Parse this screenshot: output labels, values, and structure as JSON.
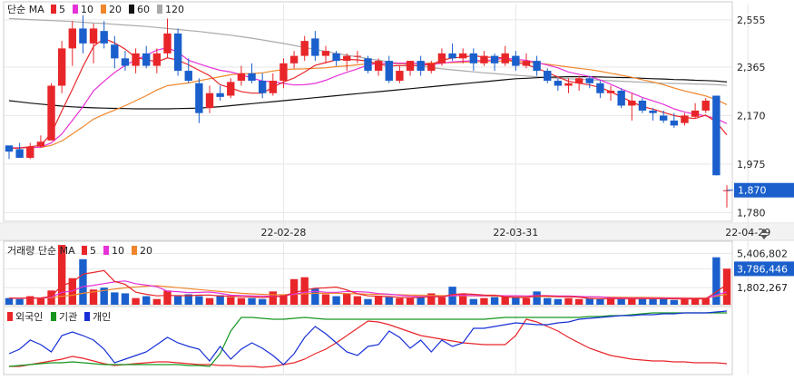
{
  "colors": {
    "up": "#e8262a",
    "down": "#1a5fcc",
    "ma5": "#e8262a",
    "ma10": "#e632d8",
    "ma20": "#f0862b",
    "ma60": "#111111",
    "ma120": "#aaaaaa",
    "foreign": "#e8262a",
    "institution": "#14961e",
    "individual": "#1730d6",
    "grid": "#e6e6e6",
    "axis_text": "#222222",
    "current_price_bg": "#1a5fcc"
  },
  "price_legend": {
    "prefix": "단순 MA",
    "items": [
      {
        "label": "5",
        "color": "#e8262a"
      },
      {
        "label": "10",
        "color": "#e632d8"
      },
      {
        "label": "20",
        "color": "#f0862b"
      },
      {
        "label": "60",
        "color": "#111111"
      },
      {
        "label": "120",
        "color": "#aaaaaa"
      }
    ]
  },
  "volume_legend": {
    "prefix": "거래량 단순 MA",
    "items": [
      {
        "label": "5",
        "color": "#e8262a"
      },
      {
        "label": "10",
        "color": "#e632d8"
      },
      {
        "label": "20",
        "color": "#f0862b"
      }
    ]
  },
  "investor_legend": {
    "items": [
      {
        "label": "외국인",
        "color": "#e8262a"
      },
      {
        "label": "기관",
        "color": "#14961e"
      },
      {
        "label": "개인",
        "color": "#1730d6"
      }
    ]
  },
  "chart_data": {
    "type": "candlestick",
    "price_axis": {
      "ticks": [
        2555,
        2365,
        2170,
        1975,
        1780
      ],
      "labels": [
        "2,555",
        "2,365",
        "2,170",
        "1,975",
        "1,780"
      ],
      "range": [
        1745,
        2620
      ]
    },
    "current_price": {
      "value": 1870,
      "label": "1,870"
    },
    "date_labels": [
      {
        "label": "22-02-28",
        "index": 26
      },
      {
        "label": "22-03-31",
        "index": 48
      },
      {
        "label": "22-04-29",
        "index": 70
      }
    ],
    "candles": [
      [
        2050,
        2045,
        1995,
        2025
      ],
      [
        2035,
        2060,
        2000,
        2000
      ],
      [
        2000,
        2060,
        1995,
        2045
      ],
      [
        2045,
        2090,
        2040,
        2065
      ],
      [
        2070,
        2300,
        2070,
        2290
      ],
      [
        2290,
        2470,
        2260,
        2440
      ],
      [
        2440,
        2550,
        2370,
        2520
      ],
      [
        2520,
        2600,
        2420,
        2460
      ],
      [
        2460,
        2540,
        2380,
        2520
      ],
      [
        2510,
        2550,
        2440,
        2460
      ],
      [
        2455,
        2490,
        2360,
        2400
      ],
      [
        2400,
        2430,
        2350,
        2370
      ],
      [
        2370,
        2440,
        2340,
        2420
      ],
      [
        2420,
        2450,
        2360,
        2370
      ],
      [
        2370,
        2440,
        2340,
        2420
      ],
      [
        2420,
        2560,
        2400,
        2500
      ],
      [
        2500,
        2520,
        2330,
        2350
      ],
      [
        2350,
        2400,
        2300,
        2310
      ],
      [
        2300,
        2320,
        2140,
        2180
      ],
      [
        2200,
        2290,
        2180,
        2260
      ],
      [
        2260,
        2290,
        2230,
        2245
      ],
      [
        2250,
        2320,
        2240,
        2305
      ],
      [
        2310,
        2370,
        2290,
        2340
      ],
      [
        2340,
        2380,
        2300,
        2310
      ],
      [
        2310,
        2340,
        2240,
        2260
      ],
      [
        2260,
        2340,
        2250,
        2310
      ],
      [
        2310,
        2400,
        2280,
        2380
      ],
      [
        2380,
        2430,
        2360,
        2410
      ],
      [
        2410,
        2490,
        2390,
        2470
      ],
      [
        2480,
        2510,
        2390,
        2410
      ],
      [
        2410,
        2450,
        2380,
        2430
      ],
      [
        2420,
        2430,
        2370,
        2390
      ],
      [
        2390,
        2420,
        2350,
        2410
      ],
      [
        2410,
        2430,
        2380,
        2410
      ],
      [
        2400,
        2410,
        2340,
        2350
      ],
      [
        2350,
        2400,
        2330,
        2390
      ],
      [
        2390,
        2410,
        2300,
        2310
      ],
      [
        2310,
        2370,
        2300,
        2350
      ],
      [
        2350,
        2390,
        2330,
        2390
      ],
      [
        2390,
        2410,
        2330,
        2350
      ],
      [
        2350,
        2390,
        2340,
        2380
      ],
      [
        2380,
        2440,
        2370,
        2420
      ],
      [
        2420,
        2460,
        2390,
        2400
      ],
      [
        2400,
        2440,
        2380,
        2420
      ],
      [
        2420,
        2440,
        2350,
        2380
      ],
      [
        2380,
        2430,
        2370,
        2410
      ],
      [
        2410,
        2420,
        2350,
        2380
      ],
      [
        2380,
        2450,
        2370,
        2420
      ],
      [
        2410,
        2430,
        2350,
        2370
      ],
      [
        2370,
        2420,
        2360,
        2390
      ],
      [
        2390,
        2410,
        2330,
        2350
      ],
      [
        2350,
        2360,
        2300,
        2310
      ],
      [
        2310,
        2320,
        2270,
        2290
      ],
      [
        2290,
        2320,
        2260,
        2300
      ],
      [
        2300,
        2330,
        2270,
        2320
      ],
      [
        2320,
        2330,
        2280,
        2300
      ],
      [
        2300,
        2310,
        2240,
        2260
      ],
      [
        2260,
        2290,
        2230,
        2270
      ],
      [
        2270,
        2280,
        2200,
        2210
      ],
      [
        2210,
        2260,
        2150,
        2230
      ],
      [
        2230,
        2240,
        2180,
        2190
      ],
      [
        2190,
        2200,
        2150,
        2180
      ],
      [
        2170,
        2190,
        2140,
        2150
      ],
      [
        2150,
        2180,
        2120,
        2130
      ],
      [
        2140,
        2180,
        2130,
        2170
      ],
      [
        2165,
        2220,
        2160,
        2190
      ],
      [
        2190,
        2240,
        2180,
        2230
      ],
      [
        2250,
        2020,
        1930,
        1930
      ],
      [
        1870,
        1890,
        1800,
        1870
      ]
    ],
    "ma5": [
      2038,
      2040,
      2045,
      2050,
      2098,
      2189,
      2276,
      2367,
      2448,
      2480,
      2462,
      2437,
      2403,
      2395,
      2386,
      2402,
      2393,
      2374,
      2352,
      2330,
      2294,
      2281,
      2266,
      2260,
      2260,
      2284,
      2305,
      2321,
      2345,
      2372,
      2383,
      2394,
      2396,
      2394,
      2389,
      2377,
      2369,
      2371,
      2371,
      2372,
      2375,
      2392,
      2402,
      2405,
      2411,
      2405,
      2404,
      2401,
      2385,
      2375,
      2361,
      2343,
      2325,
      2308,
      2300,
      2293,
      2283,
      2266,
      2245,
      2225,
      2206,
      2196,
      2183,
      2170,
      2162,
      2158,
      2172,
      2144,
      2092
    ],
    "ma10": [
      2040,
      2041,
      2042,
      2043,
      2060,
      2096,
      2151,
      2206,
      2270,
      2308,
      2343,
      2372,
      2394,
      2413,
      2433,
      2443,
      2424,
      2392,
      2378,
      2364,
      2352,
      2345,
      2334,
      2321,
      2309,
      2306,
      2299,
      2293,
      2294,
      2299,
      2312,
      2329,
      2344,
      2358,
      2373,
      2380,
      2380,
      2381,
      2381,
      2380,
      2375,
      2380,
      2386,
      2388,
      2391,
      2391,
      2395,
      2401,
      2396,
      2392,
      2383,
      2373,
      2362,
      2345,
      2336,
      2327,
      2313,
      2296,
      2277,
      2260,
      2243,
      2229,
      2215,
      2197,
      2184,
      2176,
      2169,
      2157,
      2138
    ],
    "ma20": [
      2040,
      2040,
      2041,
      2042,
      2050,
      2068,
      2096,
      2125,
      2156,
      2175,
      2192,
      2210,
      2230,
      2250,
      2273,
      2290,
      2296,
      2301,
      2310,
      2318,
      2326,
      2334,
      2338,
      2339,
      2342,
      2349,
      2355,
      2357,
      2358,
      2360,
      2362,
      2367,
      2370,
      2374,
      2378,
      2380,
      2379,
      2378,
      2379,
      2380,
      2381,
      2382,
      2383,
      2384,
      2386,
      2387,
      2388,
      2390,
      2389,
      2386,
      2381,
      2376,
      2371,
      2365,
      2360,
      2355,
      2348,
      2340,
      2332,
      2324,
      2314,
      2305,
      2294,
      2281,
      2269,
      2259,
      2249,
      2234,
      2214
    ],
    "ma60": [
      2230,
      2225,
      2220,
      2216,
      2212,
      2208,
      2205,
      2203,
      2201,
      2200,
      2199,
      2198,
      2197,
      2197,
      2197,
      2197,
      2198,
      2199,
      2200,
      2203,
      2206,
      2210,
      2214,
      2218,
      2222,
      2226,
      2230,
      2234,
      2238,
      2242,
      2246,
      2250,
      2254,
      2258,
      2262,
      2266,
      2270,
      2274,
      2278,
      2282,
      2286,
      2290,
      2294,
      2298,
      2302,
      2306,
      2310,
      2314,
      2318,
      2320,
      2322,
      2324,
      2325,
      2326,
      2326,
      2326,
      2325,
      2324,
      2323,
      2322,
      2320,
      2318,
      2317,
      2315,
      2314,
      2312,
      2311,
      2309,
      2305
    ],
    "ma120": [
      2560,
      2558,
      2556,
      2554,
      2552,
      2550,
      2548,
      2545,
      2542,
      2540,
      2537,
      2534,
      2531,
      2528,
      2524,
      2520,
      2516,
      2512,
      2508,
      2503,
      2498,
      2493,
      2487,
      2481,
      2474,
      2467,
      2460,
      2452,
      2444,
      2436,
      2428,
      2420,
      2413,
      2406,
      2399,
      2392,
      2386,
      2380,
      2374,
      2368,
      2363,
      2358,
      2354,
      2350,
      2346,
      2342,
      2339,
      2335,
      2332,
      2329,
      2326,
      2323,
      2320,
      2318,
      2316,
      2314,
      2312,
      2310,
      2308,
      2306,
      2304,
      2302,
      2300,
      2299,
      2298,
      2297,
      2296,
      2294,
      2291
    ],
    "volume_axis": {
      "ticks": [
        5406802,
        3786446,
        1802267
      ],
      "labels": [
        "5,406,802",
        "3,786,446",
        "1,802,267"
      ],
      "max": 6500000
    },
    "volume": [
      700000,
      600000,
      900000,
      700000,
      1500000,
      6300000,
      2800000,
      4800000,
      1600000,
      1800000,
      1300000,
      1200000,
      700000,
      900000,
      600000,
      1500000,
      900000,
      1100000,
      900000,
      700000,
      1000000,
      800000,
      700000,
      700000,
      600000,
      1400000,
      1000000,
      2700000,
      2900000,
      1700000,
      1100000,
      900000,
      1200000,
      900000,
      600000,
      900000,
      800000,
      700000,
      700000,
      800000,
      1200000,
      800000,
      1900000,
      1100000,
      600000,
      700000,
      800000,
      900000,
      800000,
      700000,
      1400000,
      700000,
      600000,
      700000,
      600000,
      700000,
      600000,
      700000,
      600000,
      700000,
      600000,
      600000,
      700000,
      500000,
      600000,
      600000,
      700000,
      5000000,
      3800000
    ],
    "vol_ma5": [
      700000,
      680000,
      700000,
      720000,
      880000,
      2040000,
      2360000,
      3220000,
      3400000,
      3600000,
      2460000,
      2140000,
      1320000,
      1100000,
      940000,
      980000,
      960000,
      960000,
      1000000,
      1020000,
      920000,
      900000,
      840000,
      820000,
      760000,
      840000,
      900000,
      1280000,
      1540000,
      1740000,
      1780000,
      1860000,
      1560000,
      1160000,
      940000,
      900000,
      860000,
      780000,
      740000,
      780000,
      840000,
      840000,
      1080000,
      1160000,
      1100000,
      1020000,
      1000000,
      820000,
      760000,
      760000,
      920000,
      920000,
      840000,
      840000,
      800000,
      660000,
      640000,
      640000,
      640000,
      640000,
      640000,
      640000,
      640000,
      620000,
      600000,
      600000,
      620000,
      1360000,
      2120000
    ],
    "vol_ma10": [
      700000,
      690000,
      700000,
      705000,
      790000,
      1300000,
      1450000,
      1900000,
      2050000,
      2230000,
      2400000,
      2500000,
      2220000,
      2060000,
      1900000,
      1420000,
      1380000,
      1280000,
      1300000,
      1340000,
      1200000,
      1000000,
      980000,
      940000,
      910000,
      890000,
      930000,
      1120000,
      1300000,
      1410000,
      1320000,
      1310000,
      1400000,
      1380000,
      1320000,
      1180000,
      1110000,
      1000000,
      900000,
      860000,
      870000,
      850000,
      970000,
      990000,
      970000,
      960000,
      980000,
      950000,
      950000,
      930000,
      970000,
      960000,
      920000,
      930000,
      880000,
      840000,
      820000,
      730000,
      710000,
      700000,
      700000,
      690000,
      700000,
      680000,
      660000,
      650000,
      650000,
      1000000,
      1370000
    ],
    "vol_ma20": [
      700000,
      700000,
      700000,
      700000,
      740000,
      900000,
      1000000,
      1200000,
      1350000,
      1500000,
      1650000,
      1780000,
      1880000,
      1950000,
      2000000,
      1900000,
      1800000,
      1700000,
      1600000,
      1500000,
      1400000,
      1300000,
      1200000,
      1150000,
      1100000,
      1050000,
      1050000,
      1100000,
      1150000,
      1200000,
      1200000,
      1200000,
      1180000,
      1150000,
      1120000,
      1100000,
      1080000,
      1050000,
      1020000,
      1000000,
      980000,
      960000,
      950000,
      940000,
      930000,
      920000,
      910000,
      900000,
      890000,
      880000,
      870000,
      860000,
      850000,
      840000,
      830000,
      820000,
      810000,
      800000,
      790000,
      780000,
      770000,
      760000,
      750000,
      740000,
      730000,
      720000,
      720000,
      900000,
      1100000
    ],
    "investors": {
      "foreign": [
        404,
        404,
        402,
        400,
        398,
        396,
        393,
        395,
        398,
        401,
        403,
        402,
        401,
        400,
        399,
        399,
        400,
        401,
        402,
        402,
        403,
        403,
        404,
        404,
        405,
        404,
        402,
        400,
        396,
        390,
        385,
        378,
        370,
        362,
        354,
        355,
        358,
        362,
        366,
        370,
        372,
        374,
        376,
        378,
        379,
        380,
        380,
        380,
        370,
        352,
        355,
        360,
        365,
        372,
        378,
        384,
        388,
        392,
        394,
        396,
        397,
        398,
        398,
        399,
        399,
        400,
        400,
        400,
        401
      ],
      "institution": [
        404,
        403,
        402,
        401,
        400,
        400,
        399,
        400,
        401,
        402,
        402,
        402,
        402,
        402,
        402,
        402,
        402,
        403,
        403,
        404,
        390,
        365,
        350,
        350,
        351,
        352,
        352,
        351,
        350,
        351,
        352,
        352,
        352,
        352,
        352,
        352,
        352,
        352,
        352,
        352,
        352,
        352,
        352,
        352,
        352,
        352,
        351,
        350,
        350,
        350,
        350,
        350,
        350,
        350,
        350,
        349,
        349,
        348,
        348,
        347,
        346,
        345,
        345,
        345,
        345,
        345,
        345,
        345,
        345
      ],
      "individual": [
        390,
        385,
        375,
        380,
        388,
        370,
        366,
        370,
        375,
        385,
        400,
        396,
        392,
        388,
        380,
        372,
        378,
        382,
        385,
        398,
        382,
        396,
        385,
        378,
        384,
        392,
        402,
        390,
        372,
        360,
        368,
        378,
        388,
        392,
        382,
        380,
        365,
        372,
        384,
        375,
        388,
        375,
        382,
        378,
        362,
        362,
        360,
        358,
        356,
        357,
        358,
        358,
        356,
        355,
        352,
        351,
        350,
        349,
        348,
        348,
        347,
        347,
        346,
        346,
        345,
        345,
        345,
        344,
        343
      ]
    }
  }
}
